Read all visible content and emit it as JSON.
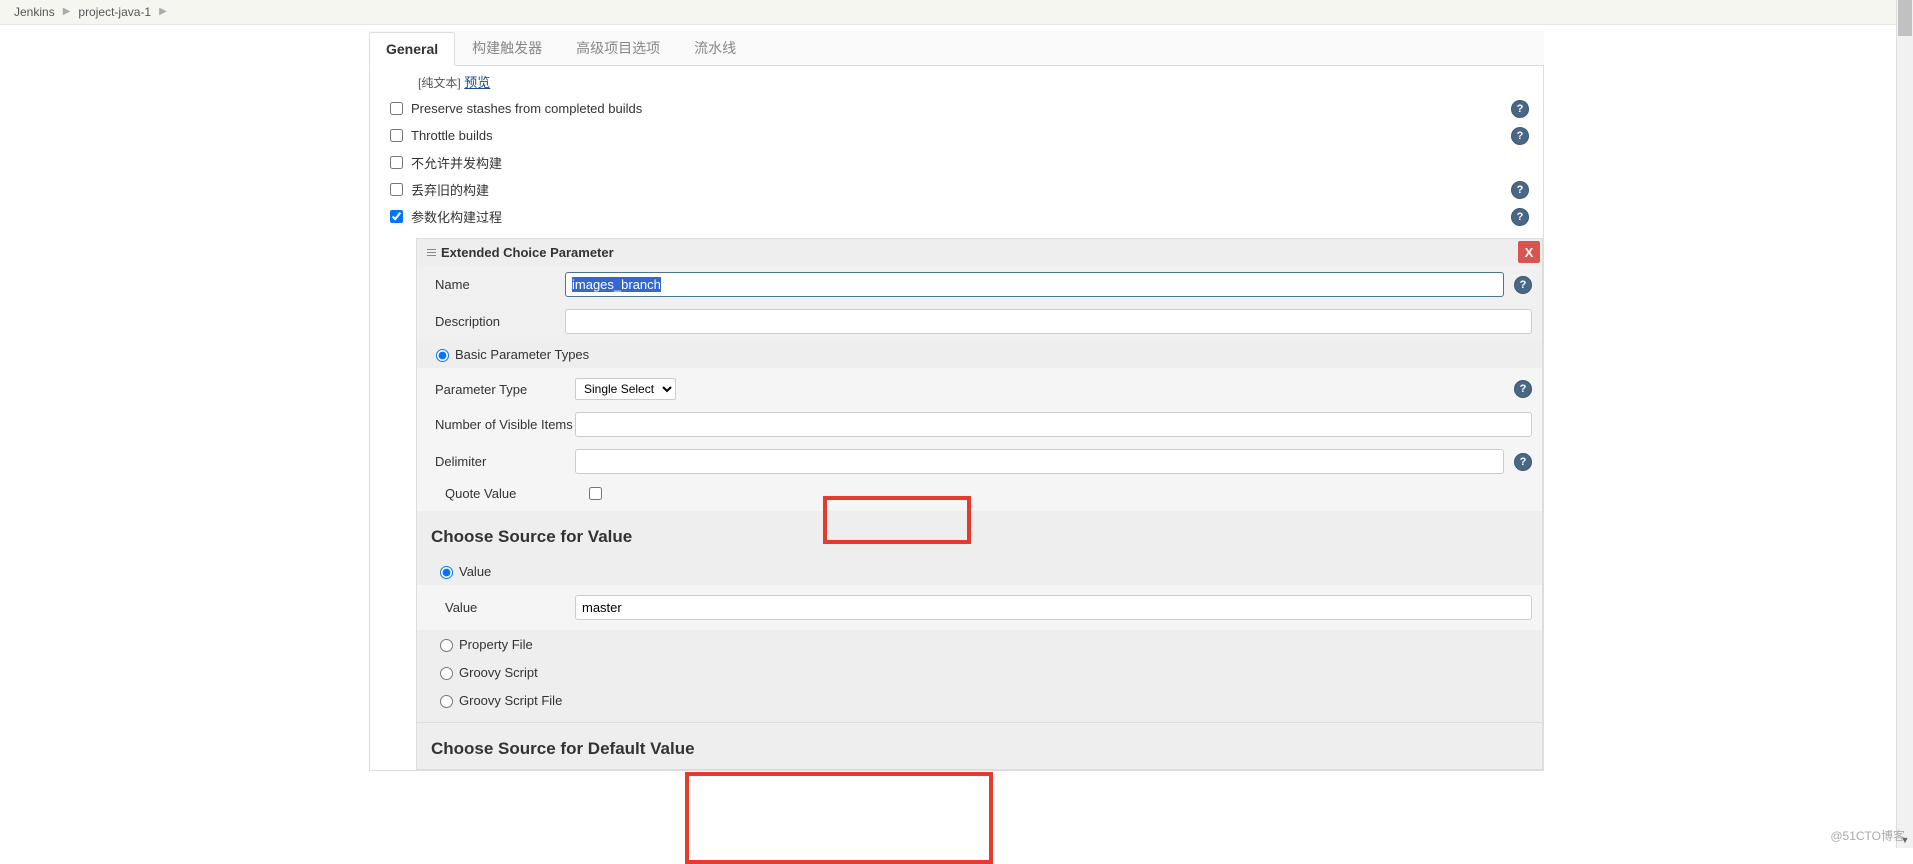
{
  "breadcrumb": {
    "items": [
      "Jenkins",
      "project-java-1"
    ]
  },
  "tabs": {
    "general": "General",
    "build_trigger": "构建触发器",
    "advanced": "高级项目选项",
    "pipeline": "流水线"
  },
  "preview": {
    "bracket": "[纯文本]",
    "link": "预览"
  },
  "options": {
    "preserve_stashes": "Preserve stashes from completed builds",
    "throttle_builds": "Throttle builds",
    "no_concurrent": "不允许并发构建",
    "discard_old": "丢弃旧的构建",
    "parameterized": "参数化构建过程"
  },
  "param": {
    "title": "Extended Choice Parameter",
    "name_label": "Name",
    "name_value": "images_branch",
    "desc_label": "Description",
    "desc_value": "",
    "basic_types": "Basic Parameter Types",
    "ptype_label": "Parameter Type",
    "ptype_value": "Single Select",
    "visible_label": "Number of Visible Items",
    "visible_value": "",
    "delim_label": "Delimiter",
    "delim_value": "",
    "quote_label": "Quote Value"
  },
  "source_value": {
    "title": "Choose Source for Value",
    "value_radio": "Value",
    "value_label": "Value",
    "value_input": "master",
    "prop_file": "Property File",
    "groovy": "Groovy Script",
    "groovy_file": "Groovy Script File"
  },
  "source_default": {
    "title": "Choose Source for Default Value"
  },
  "watermark": "@51CTO博客"
}
